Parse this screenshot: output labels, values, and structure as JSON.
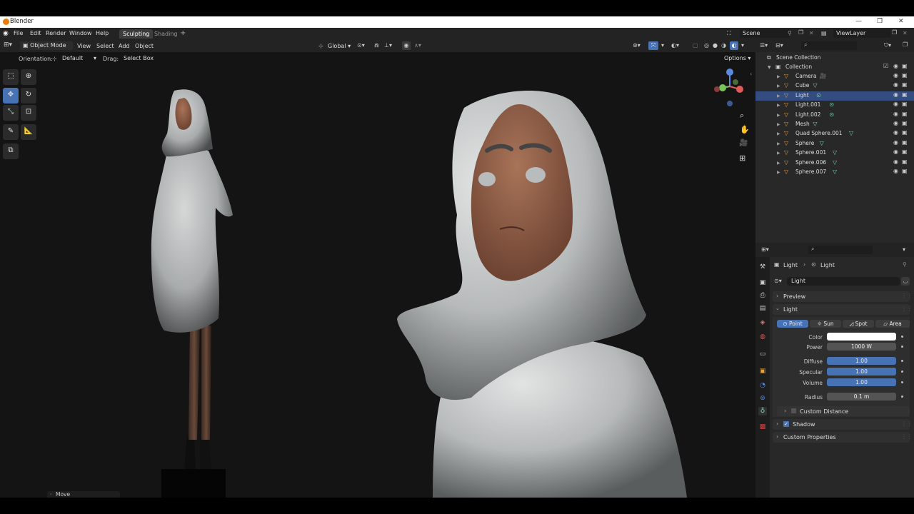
{
  "window": {
    "title": "Blender"
  },
  "menubar": {
    "items": [
      "File",
      "Edit",
      "Render",
      "Window",
      "Help"
    ],
    "workspace_tabs": [
      {
        "label": "Sculpting",
        "active": true
      },
      {
        "label": "Shading",
        "active": false
      }
    ],
    "add_tab": "+",
    "scene": "Scene",
    "view_layer": "ViewLayer"
  },
  "viewport_header": {
    "mode": "Object Mode",
    "menus": [
      "View",
      "Select",
      "Add",
      "Object"
    ],
    "transform_orientation": "Global"
  },
  "tool_settings": {
    "orientation_label": "Orientation:",
    "orientation_value": "Default",
    "drag_label": "Drag:",
    "drag_value": "Select Box",
    "options": "Options"
  },
  "operator_panel": {
    "label": "Move"
  },
  "outliner": {
    "root": "Scene Collection",
    "collection": "Collection",
    "items": [
      {
        "label": "Camera",
        "type": "camera",
        "selected": false
      },
      {
        "label": "Cube",
        "type": "mesh",
        "selected": false
      },
      {
        "label": "Light",
        "type": "light",
        "selected": true
      },
      {
        "label": "Light.001",
        "type": "light",
        "selected": false
      },
      {
        "label": "Light.002",
        "type": "light",
        "selected": false
      },
      {
        "label": "Mesh",
        "type": "mesh",
        "selected": false
      },
      {
        "label": "Quad Sphere.001",
        "type": "mesh",
        "selected": false
      },
      {
        "label": "Sphere",
        "type": "mesh",
        "selected": false
      },
      {
        "label": "Sphere.001",
        "type": "mesh",
        "selected": false
      },
      {
        "label": "Sphere.006",
        "type": "mesh",
        "selected": false
      },
      {
        "label": "Sphere.007",
        "type": "mesh",
        "selected": false
      }
    ]
  },
  "properties": {
    "breadcrumb": [
      "Light",
      "Light"
    ],
    "datablock": "Light",
    "panels": {
      "preview": "Preview",
      "light": "Light",
      "custom_distance": "Custom Distance",
      "shadow": "Shadow",
      "custom_properties": "Custom Properties"
    },
    "light_types": [
      {
        "label": "Point",
        "active": true
      },
      {
        "label": "Sun",
        "active": false
      },
      {
        "label": "Spot",
        "active": false
      },
      {
        "label": "Area",
        "active": false
      }
    ],
    "fields": {
      "color_label": "Color",
      "power_label": "Power",
      "power_value": "1000 W",
      "diffuse_label": "Diffuse",
      "diffuse_value": "1.00",
      "specular_label": "Specular",
      "specular_value": "1.00",
      "volume_label": "Volume",
      "volume_value": "1.00",
      "radius_label": "Radius",
      "radius_value": "0.1 m"
    },
    "color_value_hex": "#ffffff",
    "shadow_checked": true,
    "custom_distance_checked": false
  },
  "colors": {
    "accent": "#4772b3",
    "selection": "#334d80",
    "mesh_icon": "#7fd4b8",
    "object_icon": "#e8a13c"
  },
  "icons": {
    "eye": "eye-icon",
    "camera": "camera-icon",
    "search": "search-icon"
  }
}
